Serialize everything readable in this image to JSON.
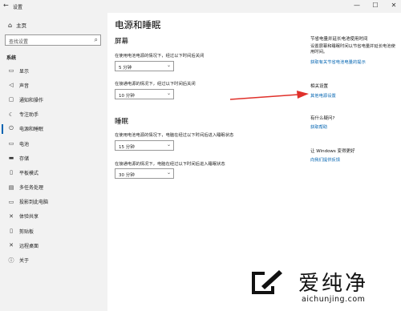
{
  "titlebar": {
    "back": "←",
    "title": "设置",
    "minimize": "—",
    "maximize": "☐",
    "close": "✕"
  },
  "sidebar": {
    "home": "主页",
    "search_placeholder": "查找设置",
    "section": "系统",
    "items": [
      {
        "icon": "monitor-icon",
        "glyph": "▭",
        "label": "显示"
      },
      {
        "icon": "speaker-icon",
        "glyph": "◁",
        "label": "声音"
      },
      {
        "icon": "notification-icon",
        "glyph": "▢",
        "label": "通知和操作"
      },
      {
        "icon": "moon-icon",
        "glyph": "☾",
        "label": "专注助手"
      },
      {
        "icon": "power-icon",
        "glyph": "⏻",
        "label": "电源和睡眠",
        "active": true
      },
      {
        "icon": "battery-icon",
        "glyph": "▭",
        "label": "电池"
      },
      {
        "icon": "storage-icon",
        "glyph": "▬",
        "label": "存储"
      },
      {
        "icon": "tablet-icon",
        "glyph": "▯",
        "label": "平板模式"
      },
      {
        "icon": "multitask-icon",
        "glyph": "▤",
        "label": "多任务处理"
      },
      {
        "icon": "project-icon",
        "glyph": "▭",
        "label": "投影到此电脑"
      },
      {
        "icon": "shared-icon",
        "glyph": "✕",
        "label": "体验共享"
      },
      {
        "icon": "clipboard-icon",
        "glyph": "▯",
        "label": "剪贴板"
      },
      {
        "icon": "remote-icon",
        "glyph": "✕",
        "label": "远程桌面"
      },
      {
        "icon": "info-icon",
        "glyph": "ⓘ",
        "label": "关于"
      }
    ]
  },
  "main": {
    "title": "电源和睡眠",
    "screen": {
      "heading": "屏幕",
      "battery_label": "在使用电池电源的情况下，经过以下时间后关闭",
      "battery_value": "5 分钟",
      "plugged_label": "在接通电源的情况下，经过以下时间后关闭",
      "plugged_value": "10 分钟"
    },
    "sleep": {
      "heading": "睡眠",
      "battery_label": "在使用电池电源的情况下，电脑在经过以下时间后进入睡眠状态",
      "battery_value": "15 分钟",
      "plugged_label": "在接通电源的情况下，电脑在经过以下时间后进入睡眠状态",
      "plugged_value": "30 分钟"
    }
  },
  "right": {
    "tip_line1": "节省电量并延长电池使用时间",
    "tip_line2": "设置屏幕和睡眠时间以节省电量并延长电池使用时间。",
    "tip_link": "获取有关节省电池电量的提示",
    "related_heading": "相关设置",
    "related_link": "其他电源设置",
    "help_heading": "有什么疑问?",
    "help_link": "获取帮助",
    "improve_heading": "让 Windows 变得更好",
    "improve_link": "向我们提供反馈"
  },
  "watermark": {
    "brand": "爱纯净",
    "url": "aichunjing.com"
  },
  "colors": {
    "accent": "#0063b1",
    "arrow": "#e0302a",
    "sidebar_bg": "#f2f2f2"
  }
}
